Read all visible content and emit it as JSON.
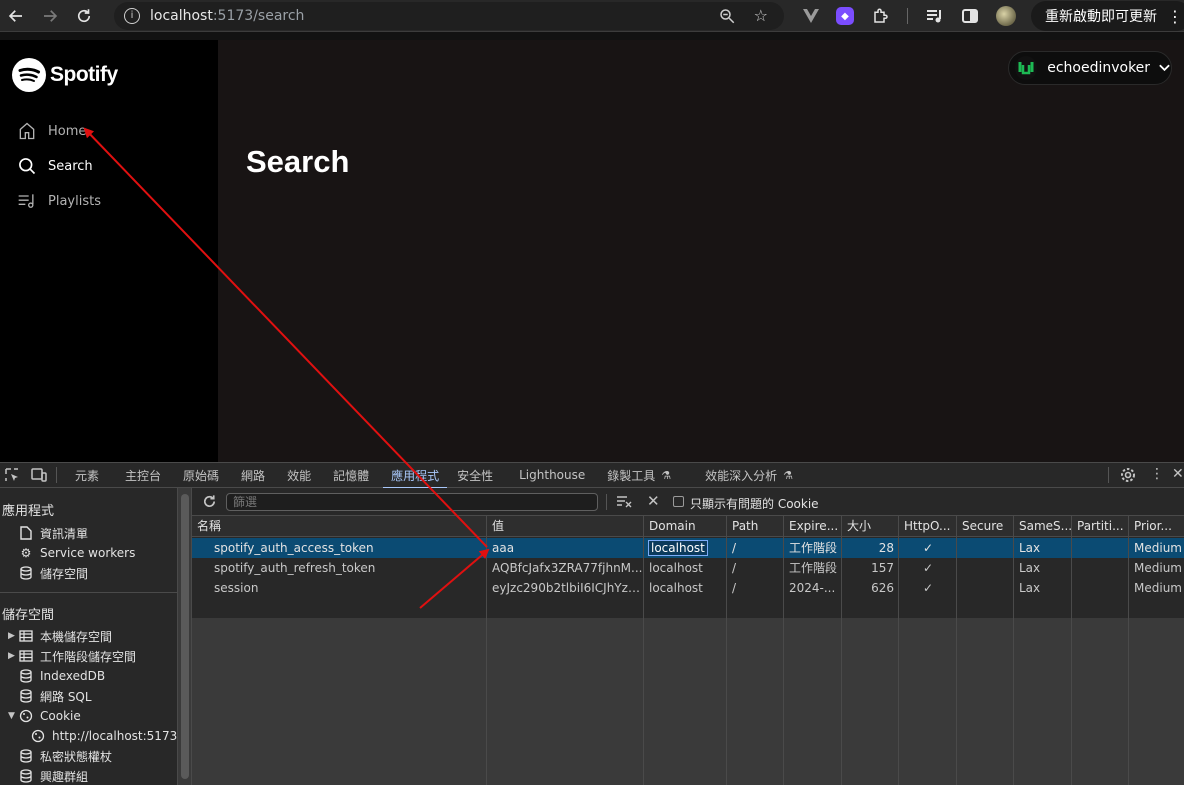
{
  "browser": {
    "url_host": "localhost",
    "url_path": ":5173/search",
    "update_button": "重新啟動即可更新"
  },
  "app": {
    "logo_text": "Spotify",
    "nav": [
      {
        "label": "Home",
        "icon": "home-icon"
      },
      {
        "label": "Search",
        "icon": "search-icon"
      },
      {
        "label": "Playlists",
        "icon": "playlist-icon"
      }
    ],
    "page_title": "Search",
    "user_name": "echoedinvoker"
  },
  "devtools": {
    "tabs": [
      "元素",
      "主控台",
      "原始碼",
      "網路",
      "效能",
      "記憶體",
      "應用程式",
      "安全性",
      "Lighthouse",
      "錄製工具",
      "效能深入分析"
    ],
    "active_tab": "應用程式",
    "sidebar": {
      "app_header": "應用程式",
      "app_items": [
        "資訊清單",
        "Service workers",
        "儲存空間"
      ],
      "storage_header": "儲存空間",
      "storage_items": [
        "本機儲存空間",
        "工作階段儲存空間",
        "IndexedDB",
        "網路 SQL",
        "Cookie",
        "http://localhost:5173",
        "私密狀態權杖",
        "興趣群組"
      ]
    },
    "filter_placeholder": "篩選",
    "only_issues_label": "只顯示有問題的 Cookie",
    "columns": [
      "名稱",
      "值",
      "Domain",
      "Path",
      "Expire...",
      "大小",
      "HttpO...",
      "Secure",
      "SameS...",
      "Partiti...",
      "Prior..."
    ],
    "rows": [
      {
        "name": "spotify_auth_access_token",
        "value": "aaa",
        "domain": "localhost",
        "path": "/",
        "expires": "工作階段",
        "size": "28",
        "httponly": "✓",
        "secure": "",
        "samesite": "Lax",
        "partition": "",
        "priority": "Medium"
      },
      {
        "name": "spotify_auth_refresh_token",
        "value": "AQBfcJafx3ZRA77fjhnM...",
        "domain": "localhost",
        "path": "/",
        "expires": "工作階段",
        "size": "157",
        "httponly": "✓",
        "secure": "",
        "samesite": "Lax",
        "partition": "",
        "priority": "Medium"
      },
      {
        "name": "session",
        "value": "eyJzc290b2tlbiI6ICJhYzQ...",
        "domain": "localhost",
        "path": "/",
        "expires": "2024-...",
        "size": "626",
        "httponly": "✓",
        "secure": "",
        "samesite": "Lax",
        "partition": "",
        "priority": "Medium"
      }
    ]
  },
  "colors": {
    "annotation_arrow": "#e01010",
    "spotify_green": "#1db954",
    "devtools_accent": "#a8c7fa",
    "selected_row": "#0b4b73"
  }
}
